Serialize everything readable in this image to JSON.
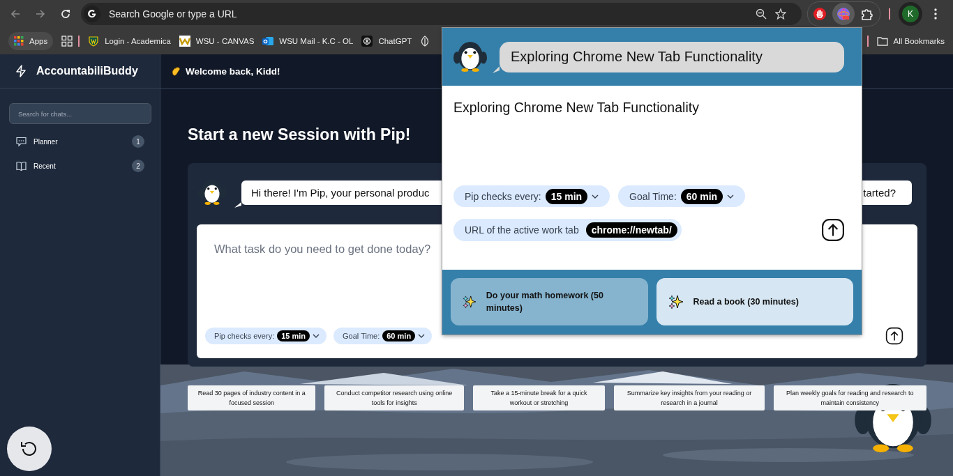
{
  "browser": {
    "omnibox_placeholder": "Search Google or type a URL",
    "profile_initial": "K",
    "all_bookmarks": "All Bookmarks",
    "bookmarks": [
      {
        "kind": "apps",
        "label": "Apps"
      },
      {
        "kind": "grid"
      },
      {
        "kind": "shield",
        "label": "Login - Academica"
      },
      {
        "kind": "w",
        "label": "WSU - CANVAS"
      },
      {
        "kind": "mail",
        "label": "WSU Mail - K.C - OL"
      },
      {
        "kind": "chatgpt",
        "label": "ChatGPT"
      },
      {
        "kind": "leaf"
      }
    ]
  },
  "sidebar": {
    "brand": "AccountabiliBuddy",
    "search_placeholder": "Search for chats...",
    "items": [
      {
        "kind": "chat",
        "label": "Planner",
        "count": "1"
      },
      {
        "kind": "book",
        "label": "Recent",
        "count": "2"
      }
    ]
  },
  "header": {
    "greeting": "Welcome back, Kidd!"
  },
  "session": {
    "title": "Start a new Session with Pip!",
    "bubble_start": "Hi there! I'm Pip, your personal produc",
    "bubble_end": "tarted?",
    "task_placeholder": "What task do you need to get done today?",
    "pills": [
      {
        "label": "Pip checks every:",
        "value": "15 min"
      },
      {
        "label": "Goal Time:",
        "value": "60 min"
      }
    ]
  },
  "suggestions": [
    "Read 30 pages of industry content in a focused session",
    "Conduct competitor research using online tools for insights",
    "Take a 15-minute break for a quick workout or stretching",
    "Summarize key insights from your reading or research in a journal",
    "Plan weekly goals for reading and research to maintain consistency"
  ],
  "popup": {
    "header_title": "Exploring Chrome New Tab Functionality",
    "title": "Exploring Chrome New Tab Functionality",
    "pills": [
      {
        "label": "Pip checks every:",
        "value": "15 min"
      },
      {
        "label": "Goal Time:",
        "value": "60 min"
      }
    ],
    "url_label": "URL of the active work tab",
    "url_value": "chrome://newtab/",
    "suggestions": [
      {
        "text": "Do your math homework (50 minutes)",
        "selected": true
      },
      {
        "text": "Read a book (30 minutes)",
        "selected": false
      }
    ]
  }
}
